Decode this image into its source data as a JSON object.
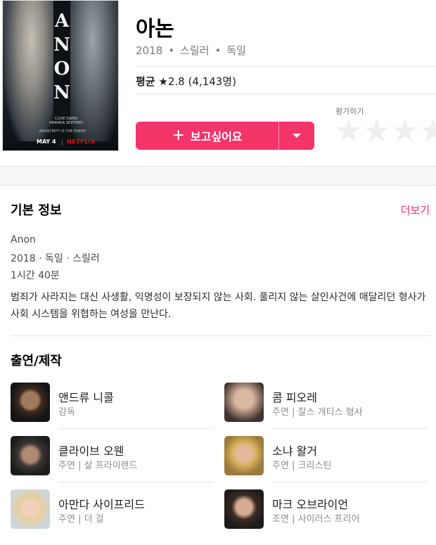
{
  "movie": {
    "title": "아논",
    "year": "2018",
    "genre": "스릴러",
    "country": "독일",
    "meta_separator": "•",
    "rating_label": "평균",
    "rating_value": "★2.8",
    "rating_count": "(4,143명)"
  },
  "poster": {
    "title_letters": [
      "A",
      "N",
      "O",
      "N"
    ],
    "credits_line1": "CLIVE OWEN",
    "credits_line2": "AMANDA SEYFRIED",
    "tagline": "ANONYMITY IS THE ENEMY",
    "date": "MAY 4",
    "separator": "|",
    "brand": "NETFLIX"
  },
  "actions": {
    "want_plus": "+",
    "want_label": "보고싶어요",
    "rate_label": "평가하기",
    "star_glyph": "★",
    "stars_shown": 4
  },
  "colors": {
    "accent": "#f4356a",
    "more_link": "#ff2f6e",
    "empty_star": "#eeeeee"
  },
  "basic_info": {
    "heading": "기본 정보",
    "more_label": "더보기",
    "original_title": "Anon",
    "year_country_genre": "2018 · 독일 · 스릴러",
    "runtime": "1시간 40분",
    "description": "범죄가 사라지는 대신 사생활, 익명성이 보장되지 않는 사회. 풀리지 않는 살인사건에 매달리던 형사가 사회 시스템을 위협하는 여성을 만난다."
  },
  "cast": {
    "heading": "출연/제작",
    "people": [
      {
        "name": "앤드류 니콜",
        "role": "감독"
      },
      {
        "name": "콤 피오레",
        "role": "주연 | 찰스 개티스 형사"
      },
      {
        "name": "클라이브 오웬",
        "role": "주연 | 살 프라이랜드"
      },
      {
        "name": "소냐 왈거",
        "role": "주연 | 크리스틴"
      },
      {
        "name": "아만다 사이프리드",
        "role": "주연 | 더 걸"
      },
      {
        "name": "마크 오브라이언",
        "role": "조연 | 사이러스 프리어"
      }
    ]
  }
}
